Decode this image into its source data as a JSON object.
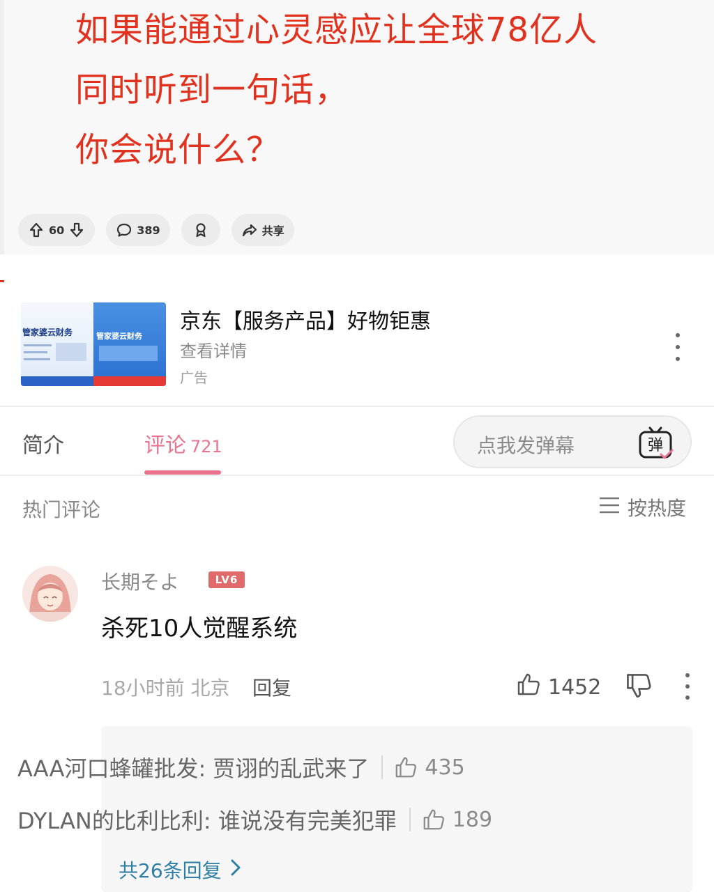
{
  "post": {
    "lines": [
      "如果能通过心灵感应让全球78亿人",
      "同时听到一句话，",
      "你会说什么？"
    ],
    "upvote_count": "60",
    "comment_count": "389",
    "share_label": "共享"
  },
  "ad": {
    "thumb_left_brand": "管家婆云财务",
    "thumb_right_brand": "管家婆云财务",
    "title": "京东【服务产品】好物钜惠",
    "subtitle": "查看详情",
    "tag": "广告"
  },
  "tabs": {
    "intro": "简介",
    "comments": "评论",
    "comments_count": "721",
    "danmaku_placeholder": "点我发弹幕",
    "danmaku_icon_char": "弹"
  },
  "comments_header": {
    "hot_label": "热门评论",
    "sort_label": "按热度"
  },
  "comment": {
    "username": "长期そよ",
    "level": "LV6",
    "text": "杀死10人觉醒系统",
    "meta": "18小时前 北京",
    "reply_label": "回复",
    "likes": "1452"
  },
  "replies": [
    {
      "text": "AAA河口蜂罐批发: 贾诩的乱武来了",
      "likes": "435"
    },
    {
      "text": "DYLAN的比利比利: 谁说没有完美犯罪",
      "likes": "189"
    }
  ],
  "replies_footer": {
    "view_all": "共26条回复"
  },
  "colors": {
    "post_text": "#e0321f",
    "accent_pink": "#e9728e",
    "link_blue": "#2f7ea3"
  }
}
